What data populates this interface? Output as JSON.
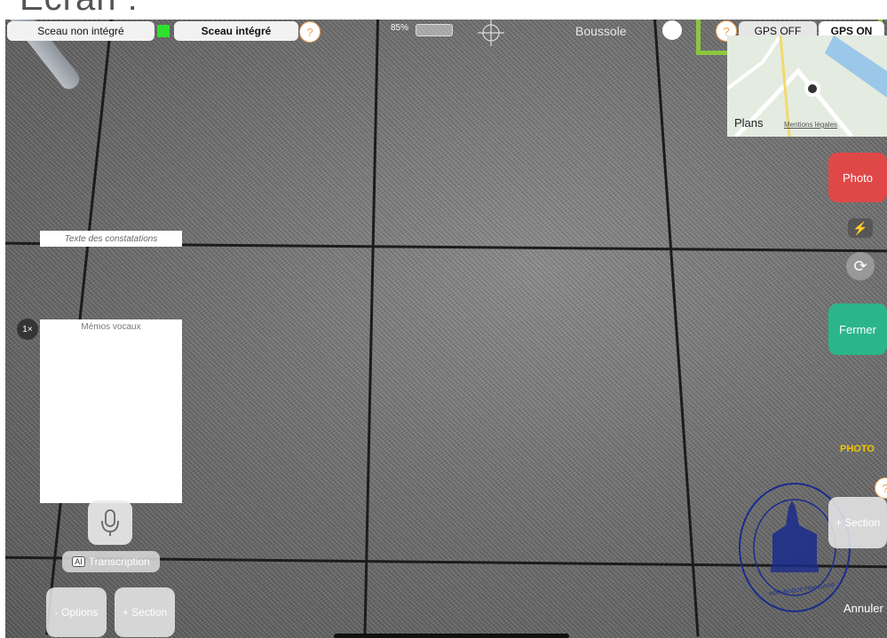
{
  "page_heading": "Écran :",
  "top_bar": {
    "seal_off_label": "Sceau non intégré",
    "seal_on_label": "Sceau intégré",
    "help_mark": "?",
    "status_text": "85%",
    "compass_label": "Boussole",
    "gps_off_label": "GPS OFF",
    "gps_on_label": "GPS ON",
    "highlight_color": "#8dc63f"
  },
  "map": {
    "brand": "Plans",
    "legal": "Mentions légales"
  },
  "right_panel": {
    "photo_button": "Photo",
    "flash_icon": "lightning-icon",
    "rotate_icon": "rotate-icon",
    "close_button": "Fermer",
    "mode_label": "PHOTO",
    "help_mark": "?",
    "section_button": "+ Section",
    "cancel_label": "Annuler",
    "photo_color": "#e04848",
    "close_color": "#2bb58a"
  },
  "left_panel": {
    "observations_placeholder": "Texte des constatations",
    "voice_memos_title": "Mémos vocaux",
    "zoom_label": "1×",
    "transcription_label": "Transcription",
    "ai_badge": "AI",
    "options_button": "- Options",
    "section_button": "+ Section"
  },
  "seal": {
    "text": "RÉPUBLIQUE FRANÇAISE"
  }
}
